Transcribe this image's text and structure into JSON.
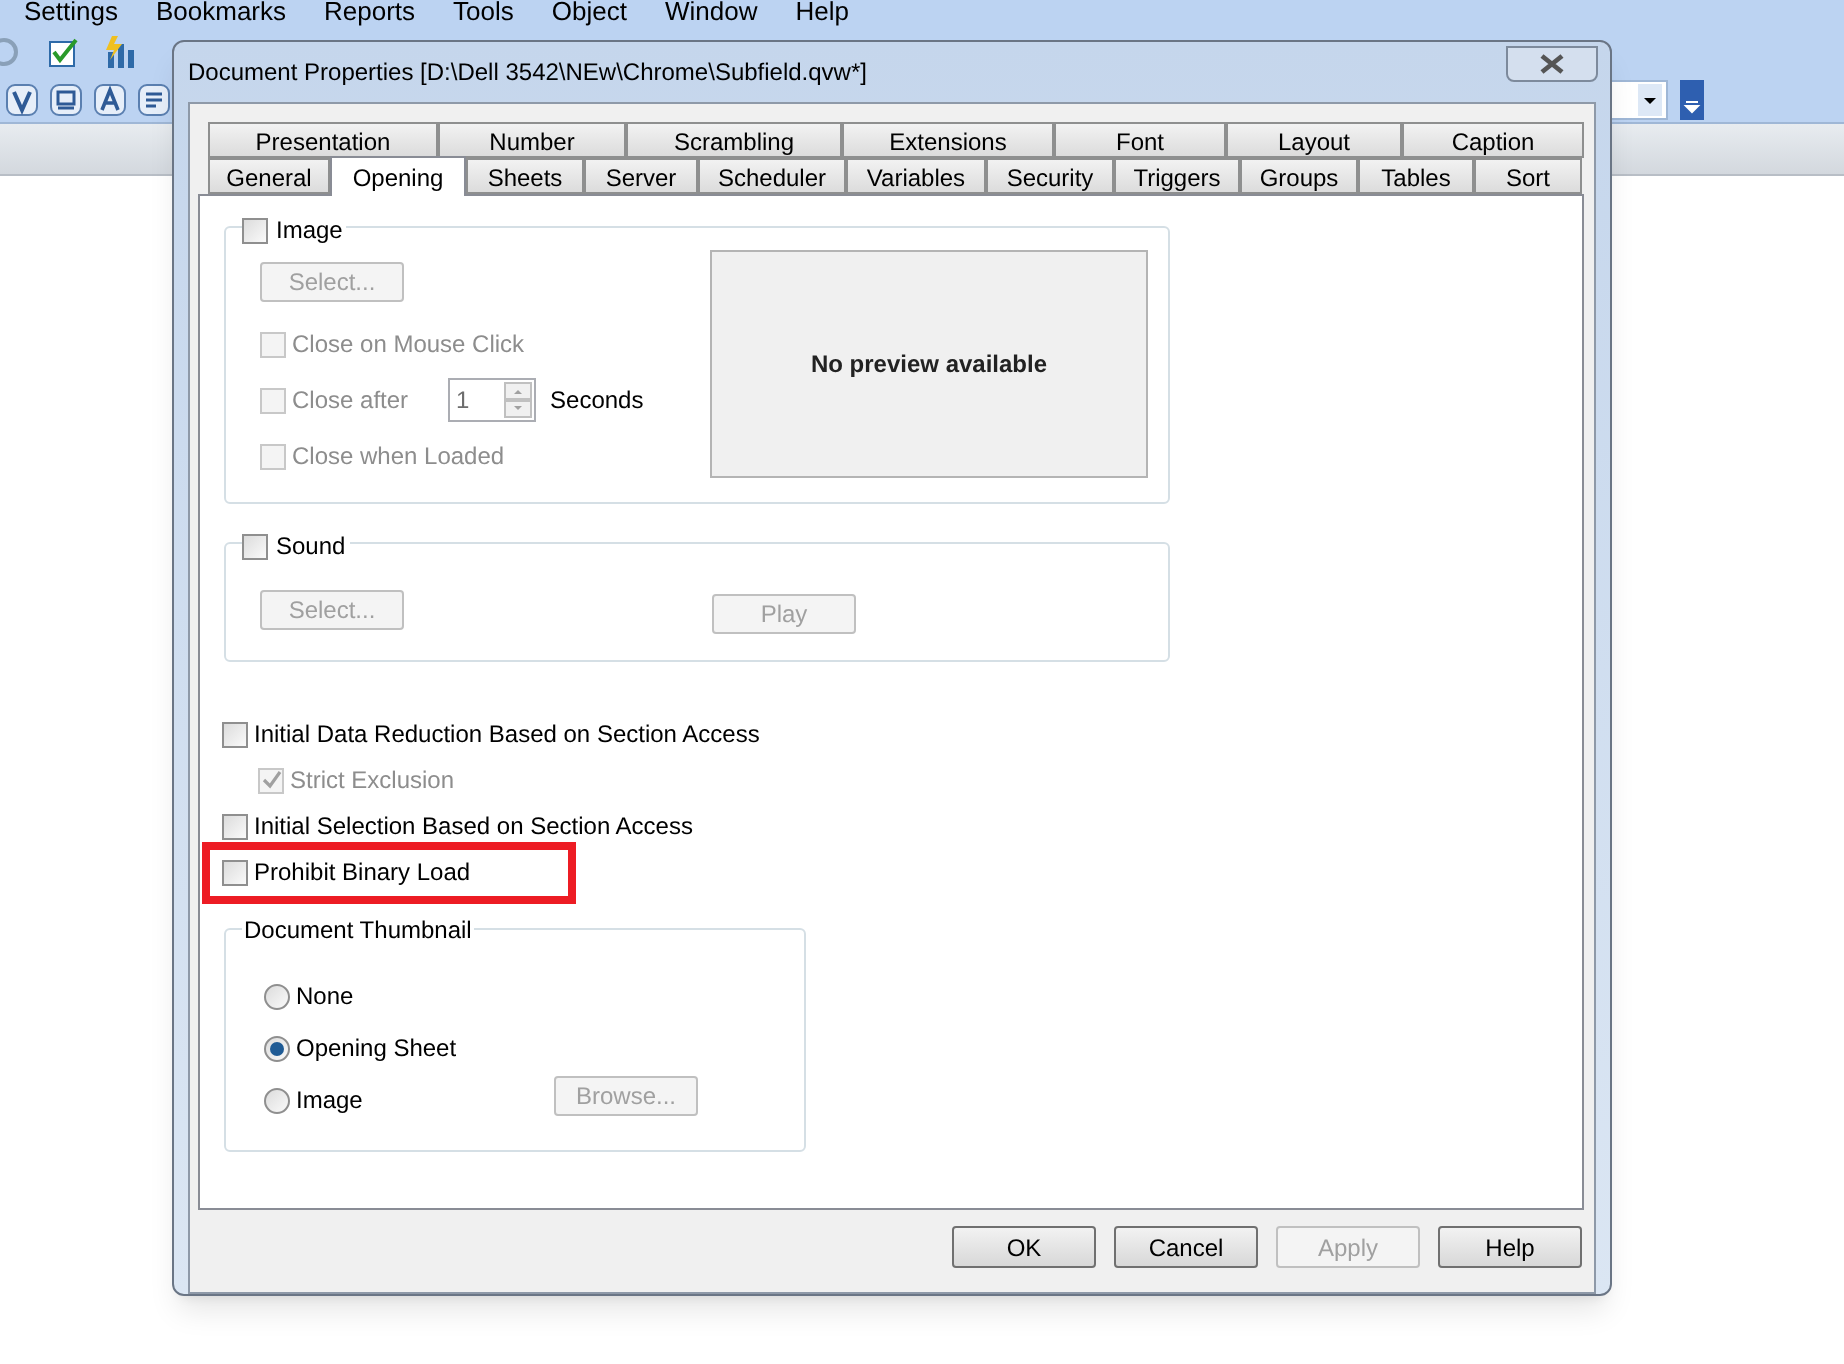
{
  "app": {
    "menu": [
      "Settings",
      "Bookmarks",
      "Reports",
      "Tools",
      "Object",
      "Window",
      "Help"
    ]
  },
  "dialog": {
    "title": "Document Properties [D:\\Dell 3542\\NEw\\Chrome\\Subfield.qvw*]",
    "tab_rows": [
      [
        {
          "label": "Presentation",
          "selected": false
        },
        {
          "label": "Number",
          "selected": false
        },
        {
          "label": "Scrambling",
          "selected": false
        },
        {
          "label": "Extensions",
          "selected": false
        },
        {
          "label": "Font",
          "selected": false
        },
        {
          "label": "Layout",
          "selected": false
        },
        {
          "label": "Caption",
          "selected": false
        }
      ],
      [
        {
          "label": "General",
          "selected": false
        },
        {
          "label": "Opening",
          "selected": true
        },
        {
          "label": "Sheets",
          "selected": false
        },
        {
          "label": "Server",
          "selected": false
        },
        {
          "label": "Scheduler",
          "selected": false
        },
        {
          "label": "Variables",
          "selected": false
        },
        {
          "label": "Security",
          "selected": false
        },
        {
          "label": "Triggers",
          "selected": false
        },
        {
          "label": "Groups",
          "selected": false
        },
        {
          "label": "Tables",
          "selected": false
        },
        {
          "label": "Sort",
          "selected": false
        }
      ]
    ],
    "image_group": {
      "label": "Image",
      "checked": false,
      "select_button": {
        "label": "Select...",
        "disabled": true
      },
      "options": [
        {
          "label": "Close on Mouse Click",
          "checked": false,
          "disabled": true
        },
        {
          "label": "Close after",
          "checked": false,
          "disabled": true,
          "spinner_value": "1",
          "unit": "Seconds"
        },
        {
          "label": "Close when Loaded",
          "checked": false,
          "disabled": true
        }
      ],
      "preview": "No preview available"
    },
    "sound_group": {
      "label": "Sound",
      "checked": false,
      "select_button": {
        "label": "Select...",
        "disabled": true
      },
      "play_button": {
        "label": "Play",
        "disabled": true
      }
    },
    "checkboxes": [
      {
        "label": "Initial Data Reduction Based on Section Access",
        "checked": false,
        "disabled": false,
        "children": [
          {
            "label": "Strict Exclusion",
            "checked": true,
            "disabled": true
          }
        ]
      },
      {
        "label": "Initial Selection Based on Section Access",
        "checked": false,
        "disabled": false
      },
      {
        "label": "Prohibit Binary Load",
        "checked": false,
        "disabled": false
      }
    ],
    "thumbnail_group": {
      "label": "Document Thumbnail",
      "options": [
        {
          "label": "None",
          "selected": false
        },
        {
          "label": "Opening Sheet",
          "selected": true
        },
        {
          "label": "Image",
          "selected": false
        }
      ],
      "browse_button": {
        "label": "Browse...",
        "disabled": true
      }
    },
    "buttons": [
      {
        "label": "OK",
        "disabled": false
      },
      {
        "label": "Cancel",
        "disabled": false
      },
      {
        "label": "Apply",
        "disabled": true
      },
      {
        "label": "Help",
        "disabled": false
      }
    ]
  }
}
